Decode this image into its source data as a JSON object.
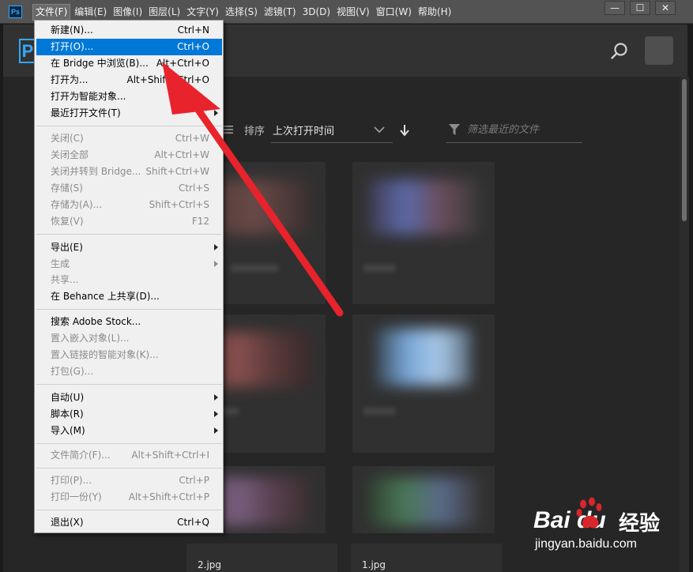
{
  "app": {
    "logo_text": "Ps",
    "home_logo_text": "P"
  },
  "menubar": [
    {
      "label": "文件(F)"
    },
    {
      "label": "编辑(E)"
    },
    {
      "label": "图像(I)"
    },
    {
      "label": "图层(L)"
    },
    {
      "label": "文字(Y)"
    },
    {
      "label": "选择(S)"
    },
    {
      "label": "滤镜(T)"
    },
    {
      "label": "3D(D)"
    },
    {
      "label": "视图(V)"
    },
    {
      "label": "窗口(W)"
    },
    {
      "label": "帮助(H)"
    }
  ],
  "window_controls": {
    "minimize": "—",
    "maximize": "☐",
    "close": "✕"
  },
  "home": {
    "sort_label": "排序",
    "sort_value": "上次打开时间",
    "filter_placeholder": "筛选最近的文件",
    "files": [
      "2.jpg",
      "1.jpg"
    ]
  },
  "file_menu": {
    "items": [
      {
        "label": "新建(N)...",
        "shortcut": "Ctrl+N",
        "disabled": false
      },
      {
        "label": "打开(O)...",
        "shortcut": "Ctrl+O",
        "disabled": false,
        "highlighted": true
      },
      {
        "label": "在 Bridge 中浏览(B)...",
        "shortcut": "Alt+Ctrl+O",
        "disabled": false
      },
      {
        "label": "打开为...",
        "shortcut": "Alt+Shift+Ctrl+O",
        "disabled": false
      },
      {
        "label": "打开为智能对象...",
        "shortcut": "",
        "disabled": false
      },
      {
        "label": "最近打开文件(T)",
        "shortcut": "",
        "disabled": false,
        "submenu": true
      },
      {
        "label": "关闭(C)",
        "shortcut": "Ctrl+W",
        "disabled": true
      },
      {
        "label": "关闭全部",
        "shortcut": "Alt+Ctrl+W",
        "disabled": true
      },
      {
        "label": "关闭并转到 Bridge...",
        "shortcut": "Shift+Ctrl+W",
        "disabled": true
      },
      {
        "label": "存储(S)",
        "shortcut": "Ctrl+S",
        "disabled": true
      },
      {
        "label": "存储为(A)...",
        "shortcut": "Shift+Ctrl+S",
        "disabled": true
      },
      {
        "label": "恢复(V)",
        "shortcut": "F12",
        "disabled": true
      },
      {
        "label": "导出(E)",
        "shortcut": "",
        "disabled": false,
        "submenu": true
      },
      {
        "label": "生成",
        "shortcut": "",
        "disabled": true,
        "submenu": true
      },
      {
        "label": "共享...",
        "shortcut": "",
        "disabled": true
      },
      {
        "label": "在 Behance 上共享(D)...",
        "shortcut": "",
        "disabled": false
      },
      {
        "label": "搜索 Adobe Stock...",
        "shortcut": "",
        "disabled": false
      },
      {
        "label": "置入嵌入对象(L)...",
        "shortcut": "",
        "disabled": true
      },
      {
        "label": "置入链接的智能对象(K)...",
        "shortcut": "",
        "disabled": true
      },
      {
        "label": "打包(G)...",
        "shortcut": "",
        "disabled": true
      },
      {
        "label": "自动(U)",
        "shortcut": "",
        "disabled": false,
        "submenu": true
      },
      {
        "label": "脚本(R)",
        "shortcut": "",
        "disabled": false,
        "submenu": true
      },
      {
        "label": "导入(M)",
        "shortcut": "",
        "disabled": false,
        "submenu": true
      },
      {
        "label": "文件简介(F)...",
        "shortcut": "Alt+Shift+Ctrl+I",
        "disabled": true
      },
      {
        "label": "打印(P)...",
        "shortcut": "Ctrl+P",
        "disabled": true
      },
      {
        "label": "打印一份(Y)",
        "shortcut": "Alt+Shift+Ctrl+P",
        "disabled": true
      },
      {
        "label": "退出(X)",
        "shortcut": "Ctrl+Q",
        "disabled": false
      }
    ]
  },
  "watermark": {
    "brand": "Bai  du",
    "cn": "经验",
    "url": "jingyan.baidu.com"
  },
  "colors": {
    "highlight": "#0078d7",
    "accent": "#31a8ff",
    "annotation_arrow": "#e8232b"
  }
}
